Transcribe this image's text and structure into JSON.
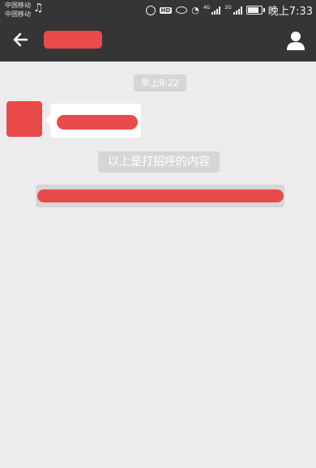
{
  "status_bar": {
    "carrier_1": "中国移动",
    "carrier_2": "中国移动",
    "hd_label": "HD",
    "network_1": "4G",
    "network_2": "2G",
    "time": "晚上7:33"
  },
  "chat": {
    "timestamp": "早上9:22",
    "greeting_notice": "以上是打招呼的内容"
  },
  "colors": {
    "bar_background": "#353535",
    "chat_background": "#ececec",
    "redaction": "#e94b4b",
    "system_pill": "#d6d6d6"
  },
  "icons": [
    "back-arrow-icon",
    "profile-icon",
    "music-icon",
    "alarm-icon",
    "eye-icon",
    "wifi-icon",
    "signal-icon",
    "battery-icon"
  ]
}
